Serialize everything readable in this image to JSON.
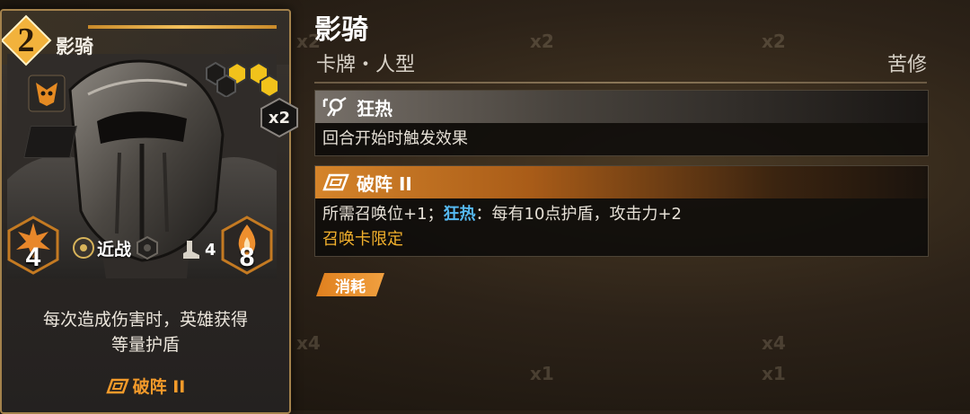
{
  "card": {
    "cost": "2",
    "name": "影骑",
    "copies": "x2",
    "attack": "4",
    "attack_type": "近战",
    "move": "4",
    "health": "8",
    "description_line1": "每次造成伤害时，英雄获得",
    "description_line2": "等量护盾",
    "keyword": "破阵 II"
  },
  "detail": {
    "title": "影骑",
    "subtitle": "卡牌・人型",
    "class": "苦修",
    "abilities": [
      {
        "name": "狂热",
        "icon": "frenzy-hand-icon",
        "description": "回合开始时触发效果"
      },
      {
        "name": "破阵 II",
        "icon": "breaker-rhombus-icon",
        "desc_part1": "所需召唤位+1；",
        "desc_highlight": "狂热",
        "desc_part2": "：每有10点护盾，攻击力+2",
        "desc_line2": "召唤卡限定"
      }
    ],
    "tag": "消耗"
  },
  "background_ghost_text": [
    "x2",
    "x2",
    "x2",
    "x4",
    "x4",
    "x1",
    "x1"
  ],
  "colors": {
    "accent_orange": "#e0801e",
    "keyword_blue": "#55b8f0",
    "gold": "#f2c05c"
  }
}
